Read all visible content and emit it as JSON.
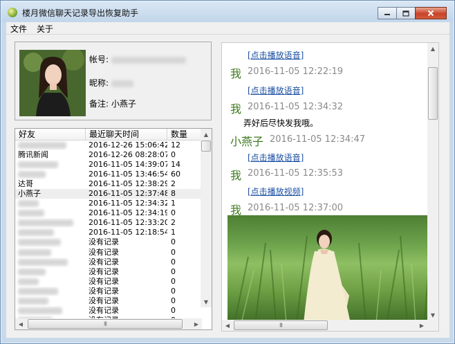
{
  "window": {
    "title": "楼月微信聊天记录导出恢复助手",
    "controls": {
      "minimize_icon": "minimize-icon",
      "maximize_icon": "maximize-icon",
      "close_icon": "close-icon"
    }
  },
  "menu": {
    "items": [
      "文件",
      "关于"
    ]
  },
  "profile": {
    "account_label": "帐号:",
    "nickname_label": "昵称:",
    "remark_label": "备注:",
    "remark_value": "小燕子"
  },
  "friends": {
    "columns": [
      "好友",
      "最近聊天时间",
      "数量"
    ],
    "rows": [
      {
        "name": "",
        "time": "2016-12-26 15:06:42",
        "count": "12"
      },
      {
        "name": "腾讯新闻",
        "time": "2016-12-26 08:28:07",
        "count": "0"
      },
      {
        "name": "",
        "time": "2016-11-05 14:39:07",
        "count": "14"
      },
      {
        "name": "",
        "time": "2016-11-05 13:46:54",
        "count": "60"
      },
      {
        "name": "达哥",
        "time": "2016-11-05 12:38:29",
        "count": "2"
      },
      {
        "name": "小燕子",
        "time": "2016-11-05 12:37:48",
        "count": "8"
      },
      {
        "name": "",
        "time": "2016-11-05 12:34:32",
        "count": "1"
      },
      {
        "name": "",
        "time": "2016-11-05 12:34:19",
        "count": "0"
      },
      {
        "name": "",
        "time": "2016-11-05 12:33:20",
        "count": "2"
      },
      {
        "name": "",
        "time": "2016-11-05 12:18:54",
        "count": "1"
      },
      {
        "name": "",
        "time": "没有记录",
        "count": "0"
      },
      {
        "name": "",
        "time": "没有记录",
        "count": "0"
      },
      {
        "name": "",
        "time": "没有记录",
        "count": "0"
      },
      {
        "name": "",
        "time": "没有记录",
        "count": "0"
      },
      {
        "name": "",
        "time": "没有记录",
        "count": "0"
      },
      {
        "name": "",
        "time": "没有记录",
        "count": "0"
      },
      {
        "name": "",
        "time": "没有记录",
        "count": "0"
      },
      {
        "name": "",
        "time": "没有记录",
        "count": "0"
      },
      {
        "name": "",
        "time": "没有记录",
        "count": "0"
      }
    ]
  },
  "chat": {
    "messages": [
      {
        "type": "link",
        "text": "[点击播放语音]"
      },
      {
        "type": "header",
        "speaker": "我",
        "time": "2016-11-05 12:22:19"
      },
      {
        "type": "link",
        "text": "[点击播放语音]"
      },
      {
        "type": "header",
        "speaker": "我",
        "time": "2016-11-05 12:34:32"
      },
      {
        "type": "text",
        "text": "弄好后尽快发我哦。"
      },
      {
        "type": "header",
        "speaker": "小燕子",
        "time": "2016-11-05 12:34:47"
      },
      {
        "type": "link",
        "text": "[点击播放语音]"
      },
      {
        "type": "header",
        "speaker": "我",
        "time": "2016-11-05 12:35:53"
      },
      {
        "type": "link",
        "text": "[点击播放视频]"
      },
      {
        "type": "header",
        "speaker": "我",
        "time": "2016-11-05 12:37:00"
      }
    ]
  },
  "scrollbar": {
    "grip": "III"
  }
}
